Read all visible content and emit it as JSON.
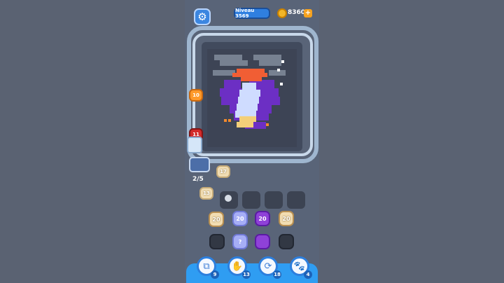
{
  "header": {
    "level_label": "Niveau 3569",
    "coins": "8360"
  },
  "side_counters": {
    "orange_pig": "10",
    "red_pig": "11"
  },
  "spawner": {
    "progress": "2/5",
    "queued_value": "17",
    "next_value": "13"
  },
  "board_numbers": {
    "row1": [
      "20",
      "20",
      "20",
      "20"
    ],
    "mystery": "?",
    "bottom_values": [
      "9",
      "13",
      "18",
      "4"
    ]
  },
  "icons": {
    "settings": "gear-icon",
    "coins": "coin-icon",
    "add": "plus-icon"
  }
}
